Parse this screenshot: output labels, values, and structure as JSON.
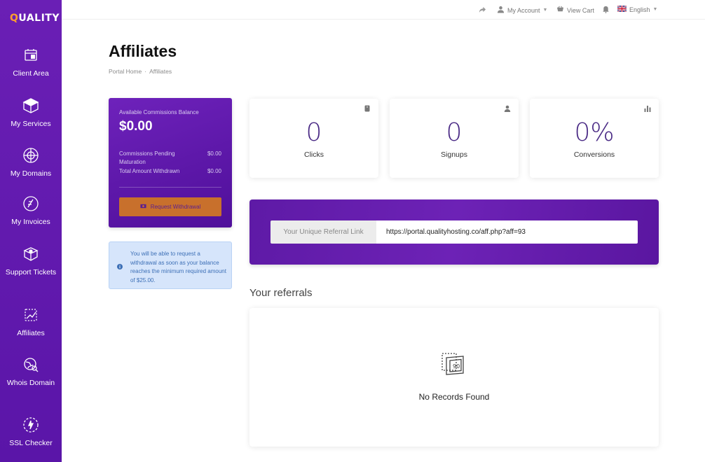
{
  "brand": {
    "logo_text": "QUALITY"
  },
  "sidebar": {
    "items": [
      {
        "label": "Client Area",
        "icon": "client-area-icon"
      },
      {
        "label": "My Services",
        "icon": "services-box-icon"
      },
      {
        "label": "My Domains",
        "icon": "domains-globe-icon"
      },
      {
        "label": "My Invoices",
        "icon": "invoice-icon"
      },
      {
        "label": "Support Tickets",
        "icon": "support-box-icon"
      },
      {
        "label": "Affiliates",
        "icon": "affiliates-chart-icon"
      },
      {
        "label": "Whois Domain",
        "icon": "whois-globe-icon"
      },
      {
        "label": "SSL Checker",
        "icon": "ssl-shield-icon"
      }
    ]
  },
  "topbar": {
    "account_label": "My Account",
    "cart_label": "View Cart",
    "language_label": "English"
  },
  "page": {
    "title": "Affiliates",
    "breadcrumb": {
      "home": "Portal Home",
      "separator": "·",
      "current": "Affiliates"
    }
  },
  "balance": {
    "label": "Available Commissions Balance",
    "amount": "$0.00",
    "pending_label": "Commissions Pending Maturation",
    "pending_value": "$0.00",
    "withdrawn_label": "Total Amount Withdrawn",
    "withdrawn_value": "$0.00",
    "button_label": "Request Withdrawal"
  },
  "info": {
    "text": "You will be able to request a withdrawal as soon as your balance reaches the minimum required amount of $25.00."
  },
  "stats": [
    {
      "value": "0",
      "label": "Clicks",
      "icon": "mouse-icon"
    },
    {
      "value": "0",
      "label": "Signups",
      "icon": "user-icon"
    },
    {
      "value": "0%",
      "label": "Conversions",
      "icon": "bar-chart-icon"
    }
  ],
  "referral": {
    "addon_label": "Your Unique Referral Link",
    "url": "https://portal.qualityhosting.co/aff.php?aff=93"
  },
  "referrals": {
    "title": "Your referrals",
    "empty_text": "No Records Found"
  },
  "colors": {
    "sidebar": "#6a1fb5",
    "accent_orange": "#c8702c",
    "stat_number": "#4a2a85",
    "info_bg": "#d6e5fb"
  }
}
